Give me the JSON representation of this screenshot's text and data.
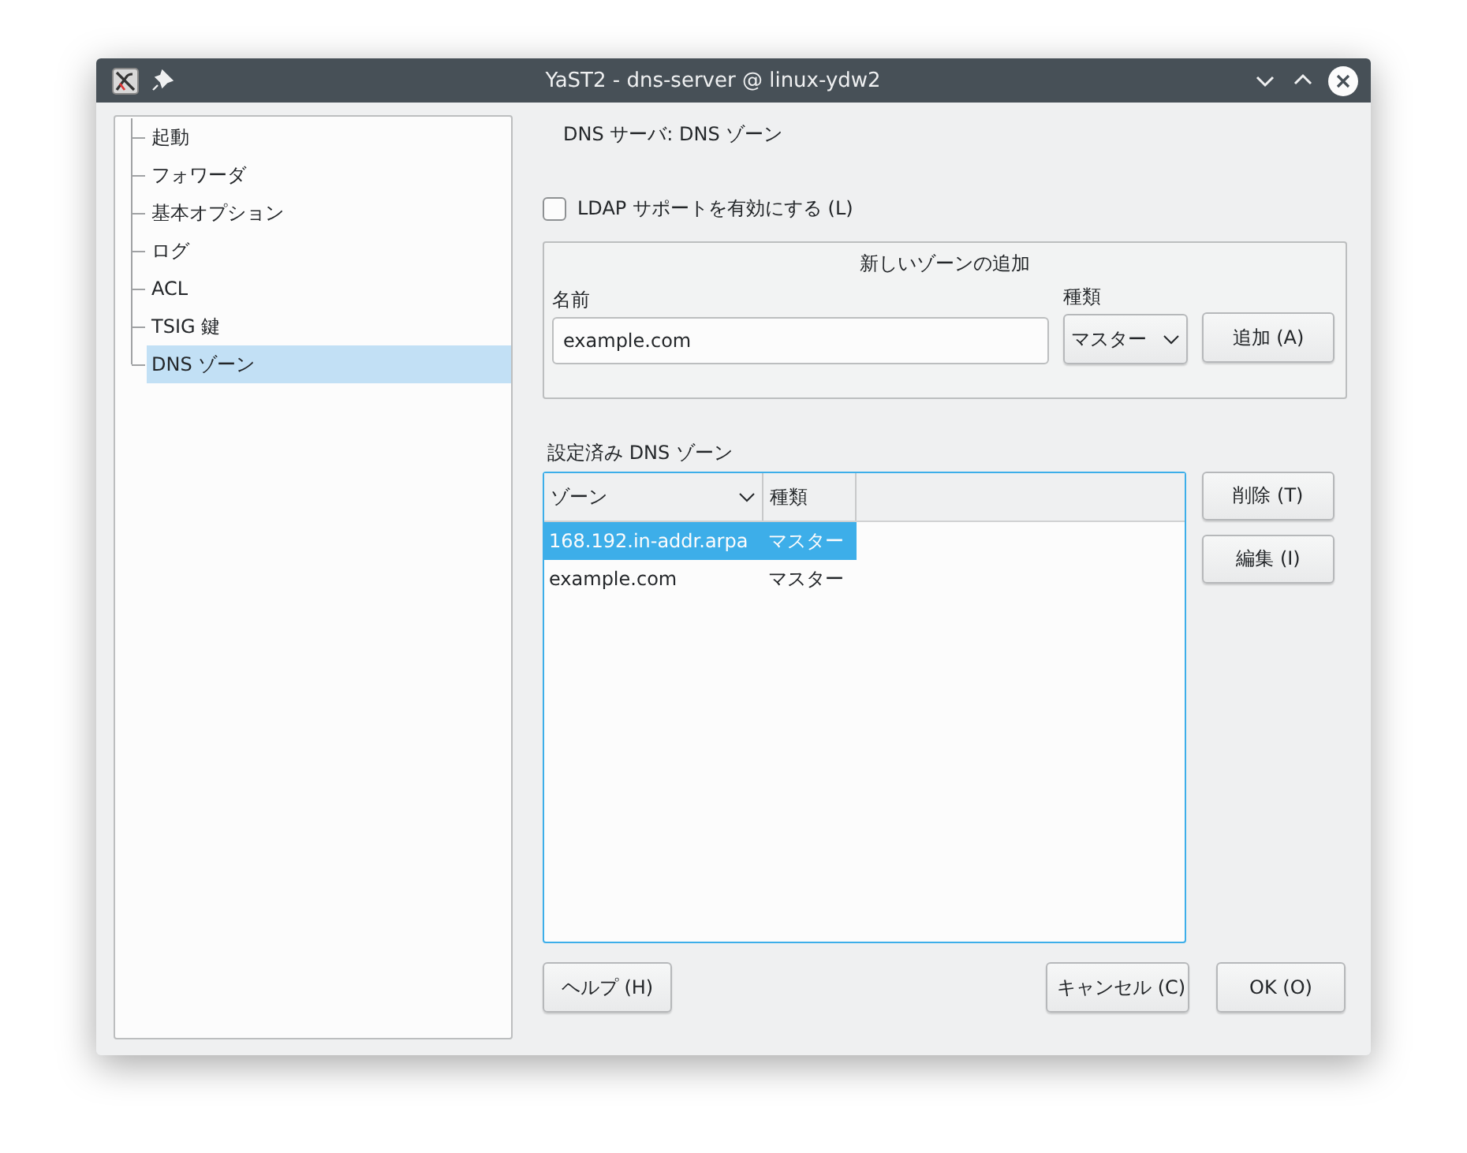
{
  "window": {
    "title": "YaST2 - dns-server @ linux-ydw2"
  },
  "sidebar": {
    "items": [
      {
        "label": "起動",
        "selected": false
      },
      {
        "label": "フォワーダ",
        "selected": false
      },
      {
        "label": "基本オプション",
        "selected": false
      },
      {
        "label": "ログ",
        "selected": false
      },
      {
        "label": "ACL",
        "selected": false
      },
      {
        "label": "TSIG 鍵",
        "selected": false
      },
      {
        "label": "DNS ゾーン",
        "selected": true
      }
    ]
  },
  "heading": "DNS サーバ: DNS ゾーン",
  "ldap_checkbox": {
    "label": "LDAP サポートを有効にする (L)",
    "checked": false
  },
  "add_zone": {
    "title": "新しいゾーンの追加",
    "name_label": "名前",
    "name_value": "example.com",
    "type_label": "種類",
    "type_value": "マスター",
    "add_button": "追加 (A)"
  },
  "zones": {
    "title": "設定済み DNS ゾーン",
    "columns": [
      "ゾーン",
      "種類"
    ],
    "rows": [
      {
        "cells": [
          "168.192.in-addr.arpa",
          "マスター"
        ],
        "selected": true
      },
      {
        "cells": [
          "example.com",
          "マスター"
        ],
        "selected": false
      }
    ],
    "buttons": [
      "削除 (T)",
      "編集 (I)"
    ]
  },
  "buttons": [
    "ヘルプ (H)",
    "キャンセル (C)",
    "OK (O)"
  ]
}
